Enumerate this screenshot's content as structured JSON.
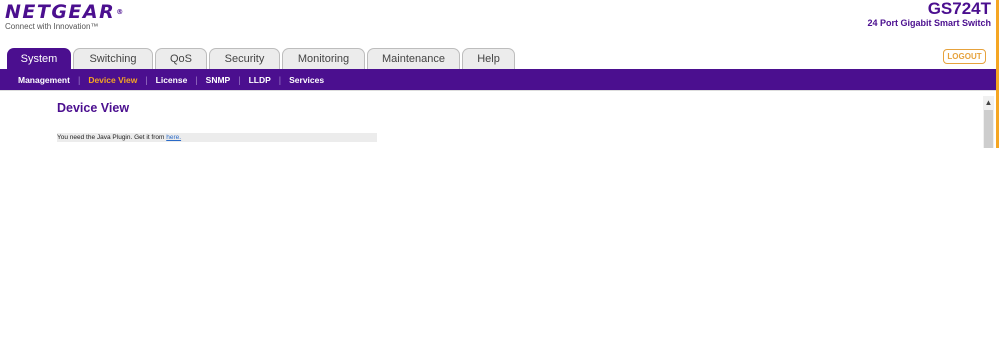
{
  "brand": {
    "logo_text": "NETGEAR",
    "logo_mark": "®",
    "tagline": "Connect with Innovation™"
  },
  "device": {
    "model": "GS724T",
    "description": "24 Port Gigabit Smart Switch"
  },
  "tabs": [
    {
      "label": "System",
      "active": true
    },
    {
      "label": "Switching",
      "active": false
    },
    {
      "label": "QoS",
      "active": false
    },
    {
      "label": "Security",
      "active": false
    },
    {
      "label": "Monitoring",
      "active": false
    },
    {
      "label": "Maintenance",
      "active": false
    },
    {
      "label": "Help",
      "active": false
    }
  ],
  "logout_label": "LOGOUT",
  "subnav": [
    {
      "label": "Management",
      "active": false
    },
    {
      "label": "Device View",
      "active": true
    },
    {
      "label": "License",
      "active": false
    },
    {
      "label": "SNMP",
      "active": false
    },
    {
      "label": "LLDP",
      "active": false
    },
    {
      "label": "Services",
      "active": false
    }
  ],
  "subnav_separator": "|",
  "content": {
    "title": "Device View",
    "notice_text": "You need the Java Plugin. Get it from ",
    "notice_link": "here."
  },
  "scrollbar": {
    "up_arrow": "▲"
  },
  "colors": {
    "brand_purple": "#4b0f8f",
    "accent_orange": "#f5a623"
  }
}
